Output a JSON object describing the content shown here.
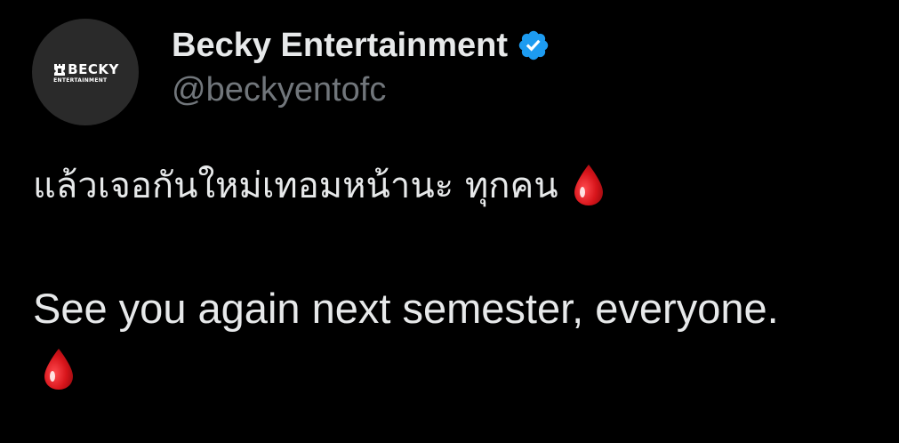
{
  "account": {
    "display_name": "Becky Entertainment",
    "handle": "@beckyentofc",
    "avatar_logo_text": "BECKY",
    "avatar_logo_subtext": "ENTERTAINMENT",
    "verified": true
  },
  "tweet": {
    "thai_line": "แล้วเจอกันใหม่เทอมหน้านะ ทุกคน",
    "english_line": "See you again next semester, everyone.",
    "emoji_name": "drop-of-blood"
  },
  "colors": {
    "background": "#000000",
    "primary_text": "#e7e9ea",
    "secondary_text": "#71767b",
    "verified_blue": "#1d9bf0",
    "avatar_bg": "#2a2a2a",
    "drop_red": "#d7141a"
  }
}
